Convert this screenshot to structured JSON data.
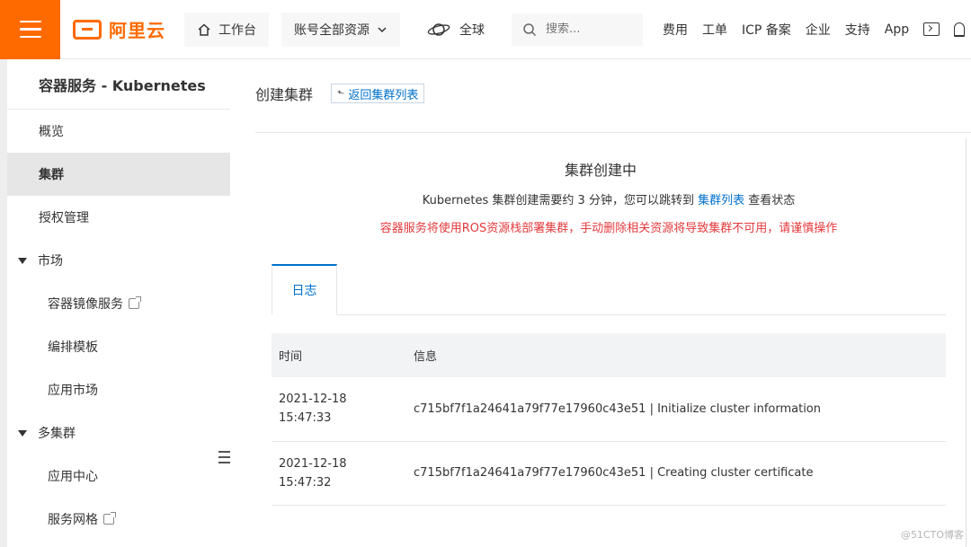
{
  "topbar": {
    "logo_text": "阿里云",
    "workbench": "工作台",
    "account_scope": "账号全部资源",
    "region": "全球",
    "search_placeholder": "搜索...",
    "links": [
      "费用",
      "工单",
      "ICP 备案",
      "企业",
      "支持",
      "App"
    ]
  },
  "sidebar": {
    "title": "容器服务 - Kubernetes",
    "items": [
      {
        "label": "概览"
      },
      {
        "label": "集群"
      },
      {
        "label": "授权管理"
      }
    ],
    "group_market": "市场",
    "market_items": [
      "容器镜像服务",
      "编排模板",
      "应用市场"
    ],
    "group_multi": "多集群",
    "multi_items": [
      "应用中心",
      "服务网格"
    ]
  },
  "main": {
    "page_title": "创建集群",
    "back_label": "返回集群列表",
    "status_title": "集群创建中",
    "status_desc_pre": "Kubernetes 集群创建需要约 3 分钟，您可以跳转到",
    "status_desc_link": "集群列表",
    "status_desc_post": "查看状态",
    "warning": "容器服务将使用ROS资源栈部署集群，手动删除相关资源将导致集群不可用，请谨慎操作",
    "tab_label": "日志",
    "table": {
      "headers": [
        "时间",
        "信息"
      ],
      "rows": [
        {
          "date": "2021-12-18",
          "time": "15:47:33",
          "message": "c715bf7f1a24641a79f77e17960c43e51 | Initialize cluster information"
        },
        {
          "date": "2021-12-18",
          "time": "15:47:32",
          "message": "c715bf7f1a24641a79f77e17960c43e51 | Creating cluster certificate"
        }
      ]
    }
  },
  "watermark": "@51CTO博客"
}
